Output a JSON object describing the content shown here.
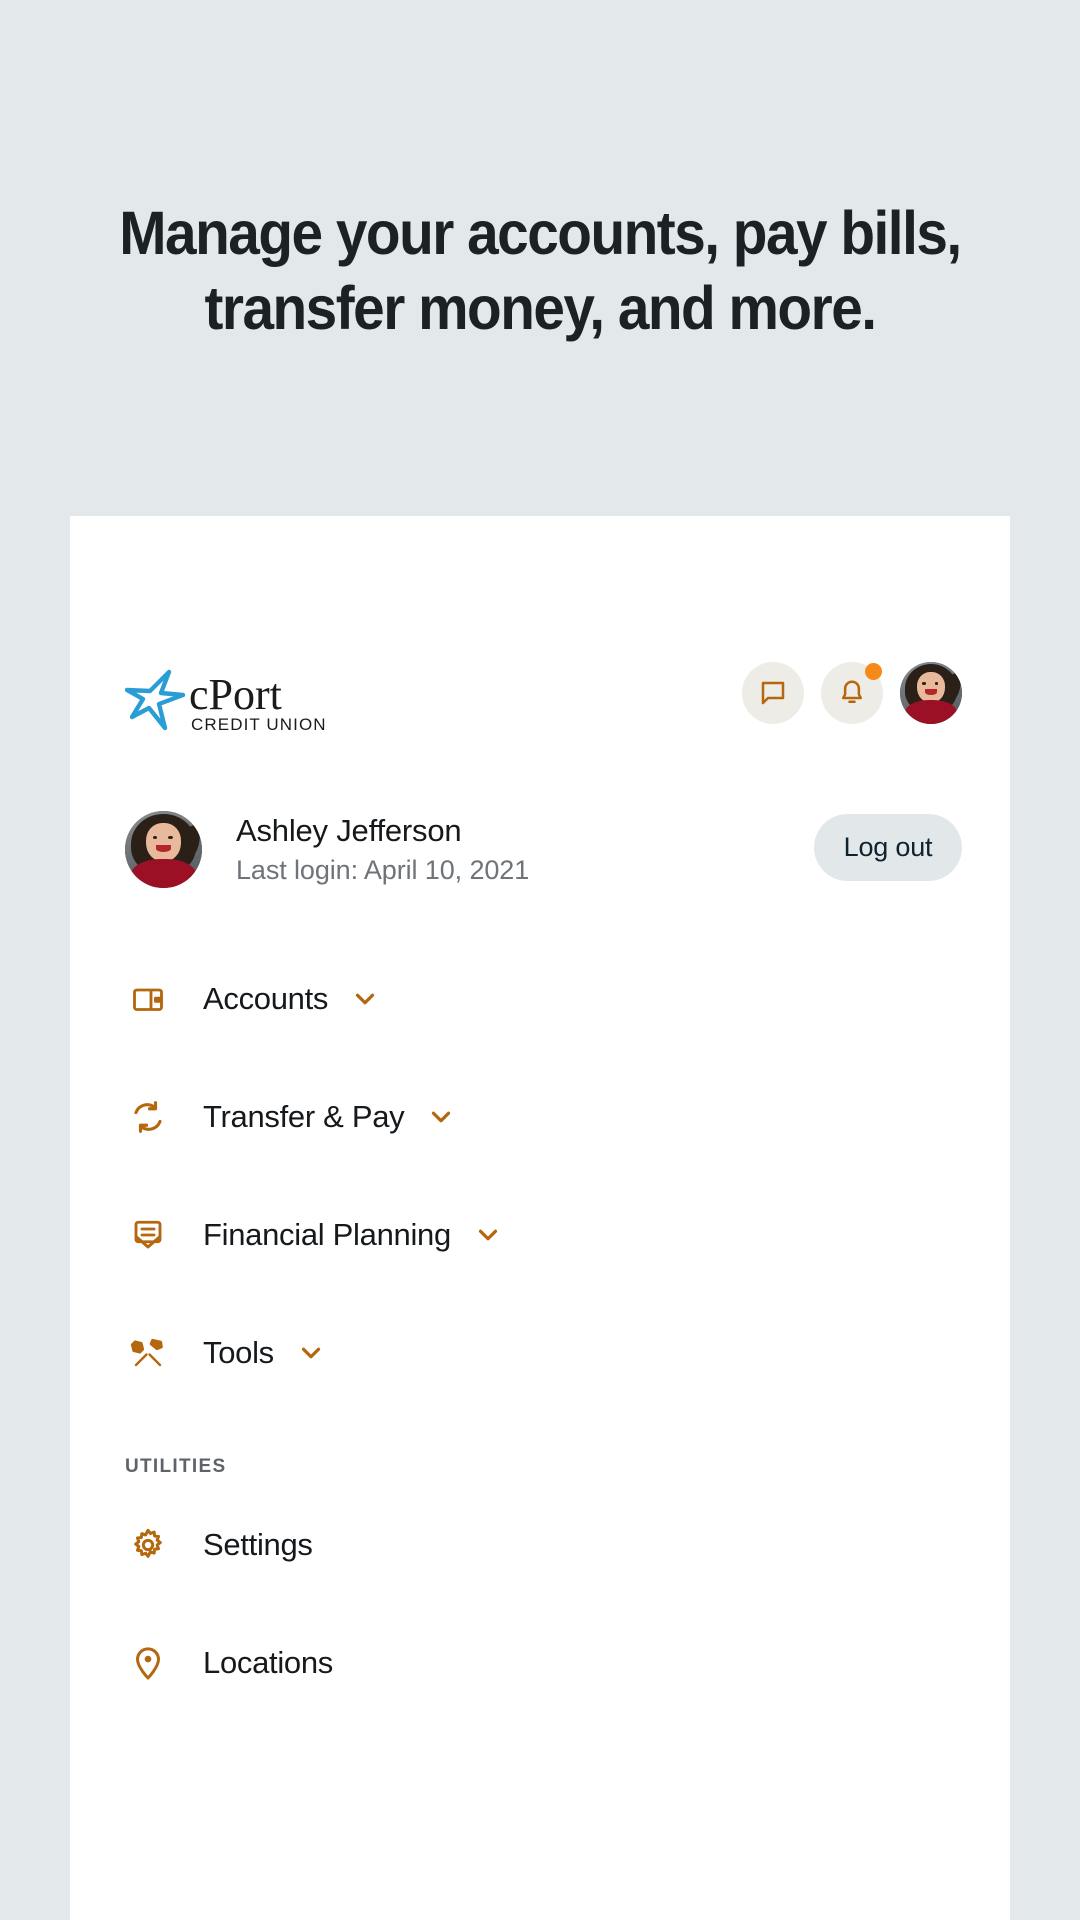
{
  "promo": {
    "line1": "Manage your accounts, pay bills,",
    "line2": "transfer money, and more."
  },
  "colors": {
    "page_background": "#e3e8ea",
    "card_background": "#ffffff",
    "accent_orange": "#b5670d",
    "badge_orange": "#f7891a",
    "logo_blue": "#2a9ed4",
    "text_primary": "#16191c",
    "text_muted": "#6e7479",
    "logout_pill": "#e2e8ea",
    "icon_circle": "#eeece6"
  },
  "app_header": {
    "logo": {
      "name": "cPort",
      "tagline": "CREDIT UNION",
      "star_icon": "star-icon"
    },
    "actions": [
      {
        "name": "messages-button",
        "icon": "chat-icon",
        "has_badge": false
      },
      {
        "name": "notifications-button",
        "icon": "bell-icon",
        "has_badge": true
      },
      {
        "name": "profile-avatar-button",
        "icon": "avatar",
        "has_badge": false
      }
    ]
  },
  "profile": {
    "avatar_icon": "avatar",
    "name": "Ashley Jefferson",
    "last_login": "Last login: April 10, 2021",
    "logout_label": "Log out"
  },
  "nav": {
    "primary": [
      {
        "label": "Accounts",
        "icon": "wallet-icon",
        "expandable": true
      },
      {
        "label": "Transfer & Pay",
        "icon": "sync-icon",
        "expandable": true
      },
      {
        "label": "Financial Planning",
        "icon": "envelope-icon",
        "expandable": true
      },
      {
        "label": "Tools",
        "icon": "tools-icon",
        "expandable": true
      }
    ],
    "utilities_header": "UTILITIES",
    "utilities": [
      {
        "label": "Settings",
        "icon": "gear-icon",
        "expandable": false
      },
      {
        "label": "Locations",
        "icon": "map-pin-icon",
        "expandable": false
      }
    ]
  }
}
